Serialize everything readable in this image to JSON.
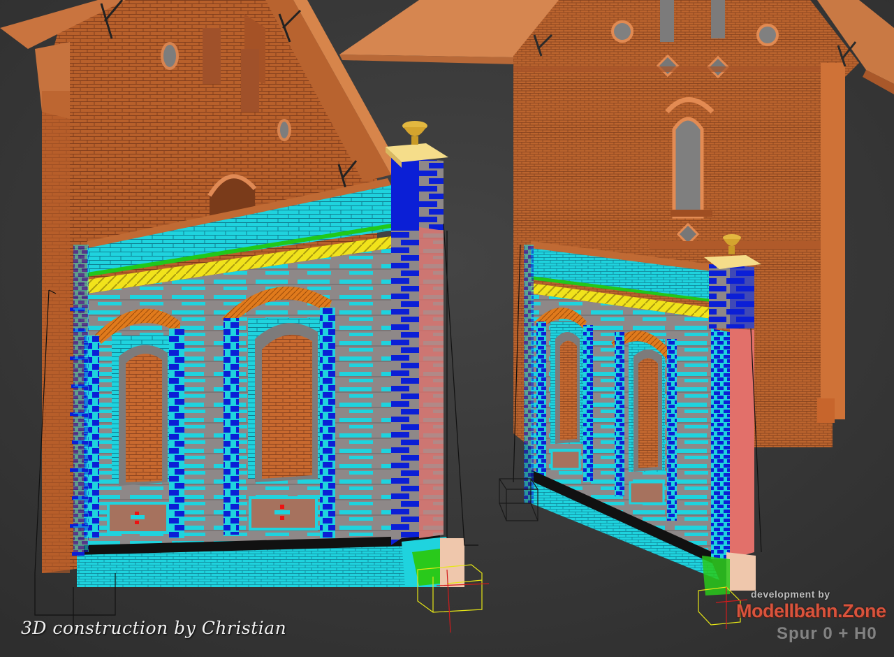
{
  "caption": "3D construction by Christian",
  "watermark": {
    "line1": "development by",
    "brand": "Modellbahn.Zone",
    "line2": "Spur 0 + H0"
  },
  "colors": {
    "background": "#3a3a3a",
    "brick": "#c96a33",
    "mortar": "#8a4320",
    "cyan_brick": "#22d6e0",
    "blue_brick": "#0b1fd6",
    "gray_brick": "#8f8a8a",
    "yellow_band": "#f2e21a",
    "green_trim": "#22c41a",
    "orange_arch": "#e0781a",
    "cap_stone": "#f4d88a",
    "plinth": "#efc9ae"
  }
}
